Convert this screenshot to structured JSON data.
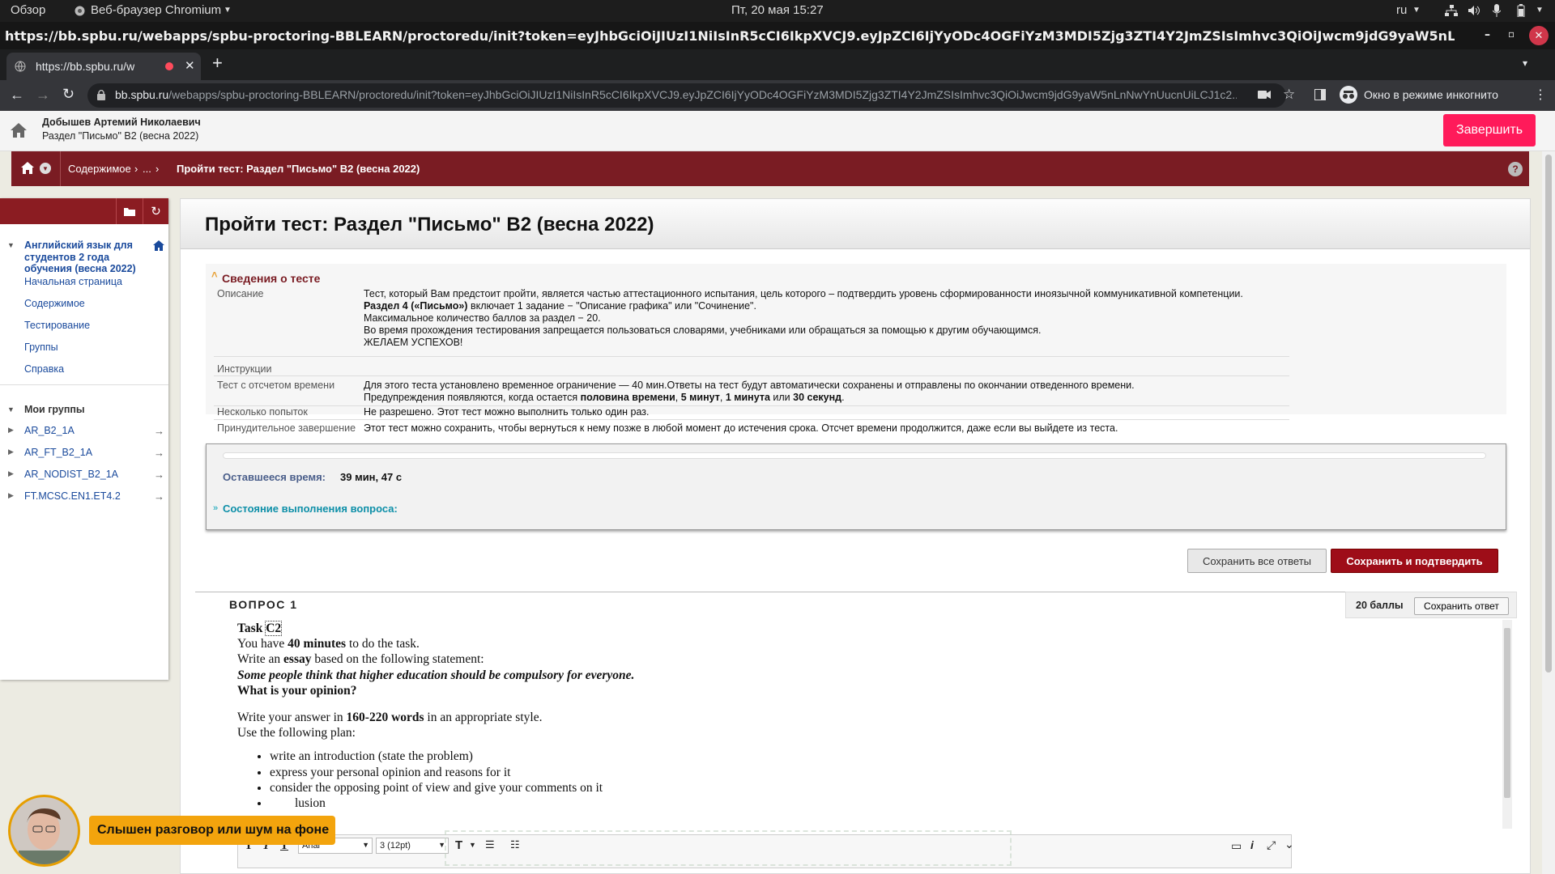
{
  "gnome": {
    "activities": "Обзор",
    "app": "Веб-браузер Chromium",
    "clock": "Пт, 20 мая  15:27",
    "lang": "ru"
  },
  "window": {
    "title": "https://bb.spbu.ru/webapps/spbu-proctoring-BBLEARN/proctoredu/init?token=eyJhbGciOiJIUzI1NiIsInR5cCI6IkpXVCJ9.eyJpZCI6IjYyODc4OGFiYzM3MDI5Zjg3ZTI4Y2JmZSIsImhvc3QiOiJwcm9jdG9yaW5nLnNwYnUucnUiLCJ1c2VybmFtZSI6ImJiLXN0MDg2OD..."
  },
  "tab": {
    "title": "https://bb.spbu.ru/we"
  },
  "omnibox": {
    "host": "bb.spbu.ru",
    "path": "/webapps/spbu-proctoring-BBLEARN/proctoredu/init?token=eyJhbGciOiJIUzI1NiIsInR5cCI6IkpXVCJ9.eyJpZCI6IjYyODc4OGFiYzM3MDI5Zjg3ZTI4Y2JmZSIsImhvc3QiOiJwcm9jdG9yaW5nLnNwYnUucnUiLCJ1c2...",
    "incognito": "Окно в режиме инкогнито"
  },
  "proctor": {
    "user": "Добышев Артемий Николаевич",
    "section": "Раздел \"Письмо\" B2 (весна 2022)",
    "finish": "Завершить"
  },
  "breadcrumb": {
    "content": "Содержимое",
    "dots": "...",
    "current": "Пройти тест: Раздел \"Письмо\" B2 (весна 2022)"
  },
  "sidebar": {
    "course": "Английский язык для студентов 2 года обучения (весна 2022)",
    "links": [
      "Начальная страница",
      "Содержимое",
      "Тестирование",
      "Группы",
      "Справка"
    ],
    "groups_title": "Мои группы",
    "groups": [
      "AR_B2_1A",
      "AR_FT_B2_1A",
      "AR_NODIST_B2_1A",
      "FT.MCSC.EN1.ET4.2"
    ]
  },
  "test": {
    "title": "Пройти тест: Раздел \"Письмо\" B2 (весна 2022)",
    "info_title": "Сведения о тесте",
    "labels": {
      "desc": "Описание",
      "instr": "Инструкции",
      "timed": "Тест с отсчетом времени",
      "attempts": "Несколько попыток",
      "force": "Принудительное завершение"
    },
    "desc": {
      "l1": "Тест, который Вам предстоит пройти, является частью аттестационного испытания, цель которого – подтвердить уровень сформированности иноязычной коммуникативной компетенции.",
      "l2b": "Раздел 4 («Письмо»)",
      "l2": " включает 1 задание − \"Описание графика\" или \"Сочинение\".",
      "l3": "Максимальное количество баллов за раздел − 20.",
      "l4": "Во время прохождения тестирования запрещается пользоваться словарями, учебниками или обращаться за помощью к другим обучающимся.",
      "l5": "ЖЕЛАЕМ УСПЕХОВ!"
    },
    "timed": {
      "l1": "Для этого теста установлено временное ограничение — 40 мин.Ответы на тест будут автоматически сохранены и отправлены по окончании отведенного времени.",
      "l2a": "Предупреждения появляются, когда остается ",
      "b1": "половина времени",
      "c1": ", ",
      "b2": "5 минут",
      "c2": ", ",
      "b3": "1 минута",
      "c3": " или ",
      "b4": "30 секунд",
      "c4": "."
    },
    "attempts": "Не разрешено. Этот тест можно выполнить только один раз.",
    "force": "Этот тест можно сохранить, чтобы вернуться к нему позже в любой момент до истечения срока. Отсчет времени продолжится, даже если вы выйдете из теста.",
    "remaining_label": "Оставшееся время:",
    "remaining_value": "39 мин, 47 с",
    "status_label": "Состояние выполнения вопроса:",
    "save_all": "Сохранить все ответы",
    "save_submit": "Сохранить и подтвердить"
  },
  "question": {
    "label": "ВОПРОС 1",
    "points": "20 баллы",
    "save": "Сохранить ответ",
    "task": "Task",
    "task_code": "C2",
    "you_have_a": "You have ",
    "you_have_b": "40 minutes",
    "you_have_c": " to do the task.",
    "write_a": "Write an ",
    "write_b": "essay",
    "write_c": " based on the following statement:",
    "statement": "Some people think that higher education should be compulsory for everyone.",
    "opinion": "What is your opinion?",
    "answer_a": "Write your answer in ",
    "answer_b": "160-220 words",
    "answer_c": " in an appropriate style.",
    "plan": "Use the following plan:",
    "bullets": [
      "write an introduction (state the problem)",
      "express your personal opinion and reasons for it",
      "consider the opposing point of view and give your comments on it",
      "        lusion"
    ]
  },
  "editor": {
    "font": "Arial",
    "size": "3 (12pt)"
  },
  "notice": {
    "text": "Слышен разговор или шум на фоне"
  }
}
